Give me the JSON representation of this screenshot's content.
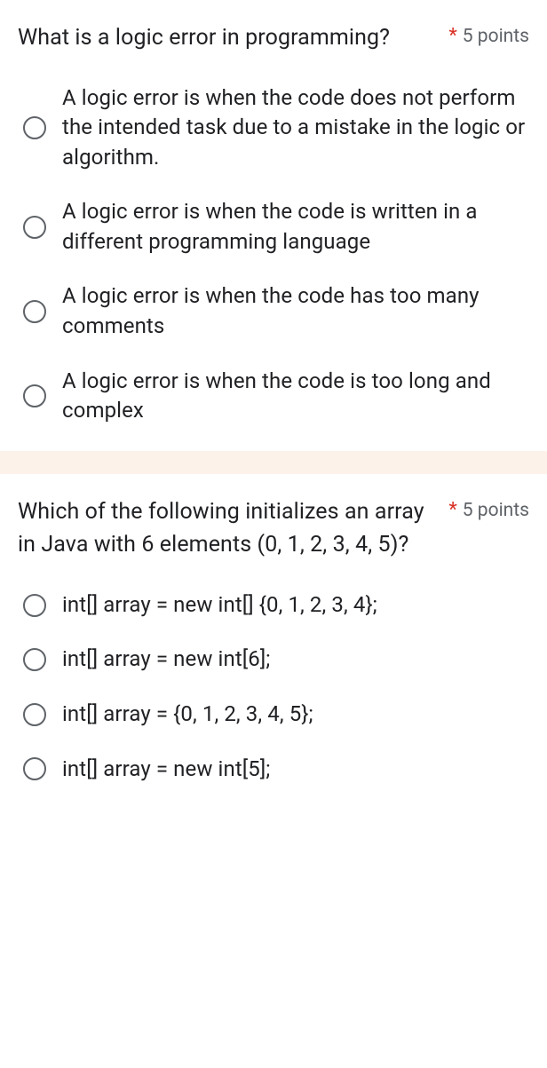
{
  "questions": [
    {
      "text": "What is a logic error in programming?",
      "required": "*",
      "points": "5 points",
      "options": [
        "A logic error is when the code does not perform the intended task due to a mistake in the logic or algorithm.",
        "A logic error is when the code is written in a different programming language",
        "A logic error is when the code has too many comments",
        "A logic error is when the code is too long and complex"
      ]
    },
    {
      "text": "Which of the following initializes an array in Java with 6 elements (0, 1, 2, 3, 4, 5)?",
      "required": "*",
      "points": "5 points",
      "options": [
        "int[] array = new int[] {0, 1, 2, 3, 4};",
        "int[] array = new int[6];",
        "int[] array = {0, 1, 2, 3, 4, 5};",
        "int[] array = new int[5];"
      ]
    }
  ]
}
